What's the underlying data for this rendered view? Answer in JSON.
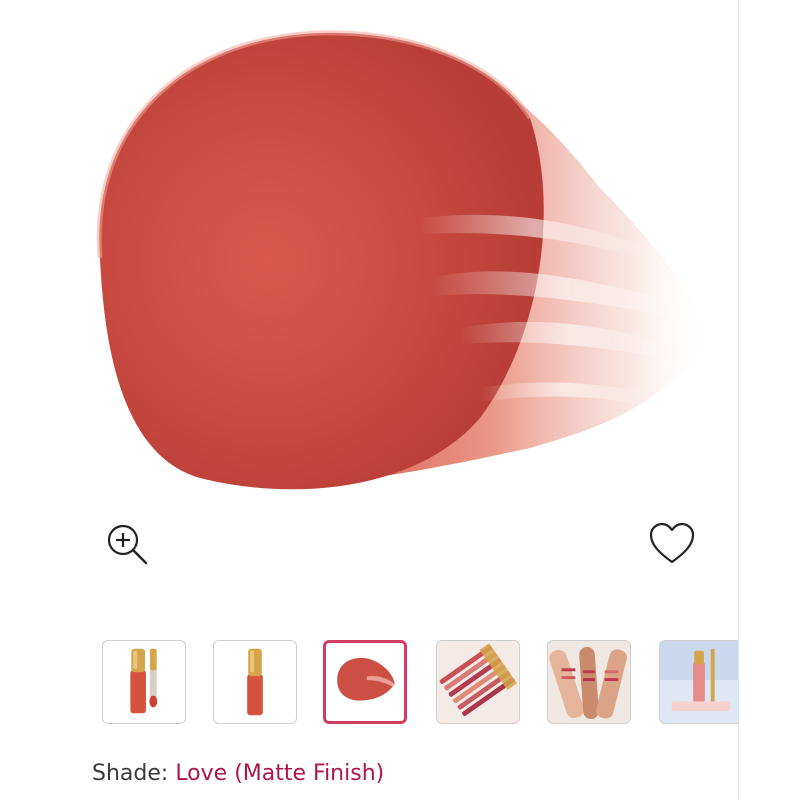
{
  "product_media": {
    "main_image": {
      "subject": "lipstick-swatch",
      "swatch_color": "#c9473e"
    },
    "zoom_icon": "magnifier-plus-icon",
    "wishlist_icon": "heart-outline-icon",
    "thumbnails": [
      {
        "subject": "lip-tint-bottle-open",
        "selected": false
      },
      {
        "subject": "lip-tint-bottle-closed",
        "selected": false
      },
      {
        "subject": "swatch-closeup",
        "selected": true
      },
      {
        "subject": "product-lineup",
        "selected": false
      },
      {
        "subject": "arm-swatches",
        "selected": false
      },
      {
        "subject": "lifestyle-shot",
        "selected": false
      }
    ],
    "accent_color": "#d23a63"
  },
  "shade": {
    "label": "Shade:",
    "value": "Love (Matte Finish)"
  }
}
